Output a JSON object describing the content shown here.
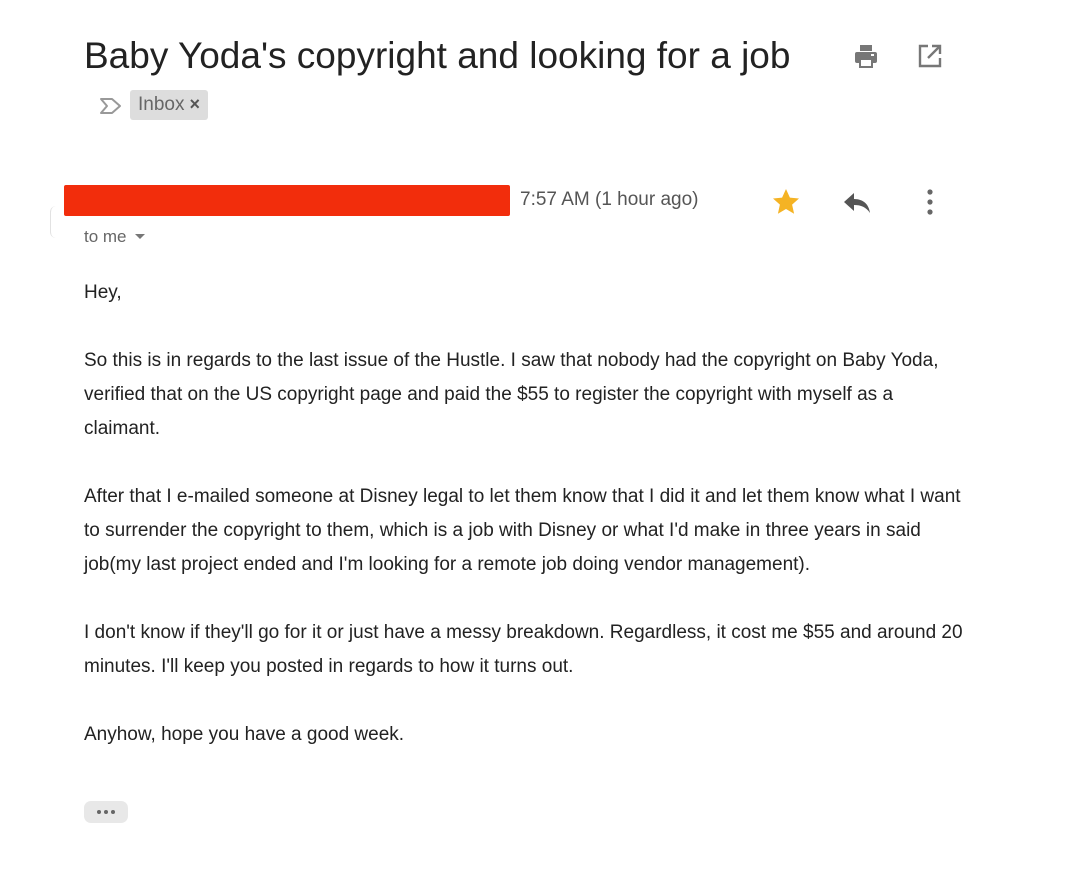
{
  "subject": {
    "title": "Baby Yoda's copyright and looking for a job",
    "importance_icon": "label-arrow-icon",
    "label": "Inbox",
    "label_remove": "×"
  },
  "toolbar": {
    "print_icon": "printer-icon",
    "open_new_window_icon": "open-in-new-window-icon"
  },
  "message": {
    "sender_redacted": true,
    "redaction_color": "#f22d0c",
    "timestamp": "7:57 AM (1 hour ago)",
    "starred": true,
    "star_color": "#f5b324",
    "recipient": "to me",
    "body": {
      "greeting": "Hey,",
      "paragraph_1": "So this is in regards to the last issue of the Hustle.  I saw that nobody had the copyright on Baby Yoda, verified that on the US copyright page and paid the $55 to register the copyright with myself as a claimant.",
      "paragraph_2": "After that I e-mailed someone at Disney legal to let them know that I did it and let them know what I want to surrender the copyright to them, which is a job with Disney or what I'd make in three years in said job(my last project ended and I'm looking for a remote job doing vendor management).",
      "paragraph_3": "I don't know if they'll go for it or just have a messy breakdown.  Regardless, it cost me $55 and around 20 minutes.  I'll keep you posted in regards to how it turns out.",
      "closing": "Anyhow, hope you have a good week."
    }
  }
}
